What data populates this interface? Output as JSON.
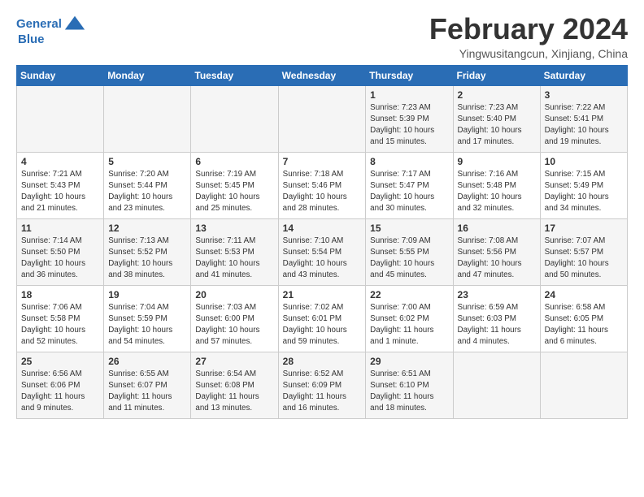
{
  "header": {
    "logo_line1": "General",
    "logo_line2": "Blue",
    "title": "February 2024",
    "location": "Yingwusitangcun, Xinjiang, China"
  },
  "days_of_week": [
    "Sunday",
    "Monday",
    "Tuesday",
    "Wednesday",
    "Thursday",
    "Friday",
    "Saturday"
  ],
  "weeks": [
    [
      {
        "day": "",
        "info": ""
      },
      {
        "day": "",
        "info": ""
      },
      {
        "day": "",
        "info": ""
      },
      {
        "day": "",
        "info": ""
      },
      {
        "day": "1",
        "info": "Sunrise: 7:23 AM\nSunset: 5:39 PM\nDaylight: 10 hours\nand 15 minutes."
      },
      {
        "day": "2",
        "info": "Sunrise: 7:23 AM\nSunset: 5:40 PM\nDaylight: 10 hours\nand 17 minutes."
      },
      {
        "day": "3",
        "info": "Sunrise: 7:22 AM\nSunset: 5:41 PM\nDaylight: 10 hours\nand 19 minutes."
      }
    ],
    [
      {
        "day": "4",
        "info": "Sunrise: 7:21 AM\nSunset: 5:43 PM\nDaylight: 10 hours\nand 21 minutes."
      },
      {
        "day": "5",
        "info": "Sunrise: 7:20 AM\nSunset: 5:44 PM\nDaylight: 10 hours\nand 23 minutes."
      },
      {
        "day": "6",
        "info": "Sunrise: 7:19 AM\nSunset: 5:45 PM\nDaylight: 10 hours\nand 25 minutes."
      },
      {
        "day": "7",
        "info": "Sunrise: 7:18 AM\nSunset: 5:46 PM\nDaylight: 10 hours\nand 28 minutes."
      },
      {
        "day": "8",
        "info": "Sunrise: 7:17 AM\nSunset: 5:47 PM\nDaylight: 10 hours\nand 30 minutes."
      },
      {
        "day": "9",
        "info": "Sunrise: 7:16 AM\nSunset: 5:48 PM\nDaylight: 10 hours\nand 32 minutes."
      },
      {
        "day": "10",
        "info": "Sunrise: 7:15 AM\nSunset: 5:49 PM\nDaylight: 10 hours\nand 34 minutes."
      }
    ],
    [
      {
        "day": "11",
        "info": "Sunrise: 7:14 AM\nSunset: 5:50 PM\nDaylight: 10 hours\nand 36 minutes."
      },
      {
        "day": "12",
        "info": "Sunrise: 7:13 AM\nSunset: 5:52 PM\nDaylight: 10 hours\nand 38 minutes."
      },
      {
        "day": "13",
        "info": "Sunrise: 7:11 AM\nSunset: 5:53 PM\nDaylight: 10 hours\nand 41 minutes."
      },
      {
        "day": "14",
        "info": "Sunrise: 7:10 AM\nSunset: 5:54 PM\nDaylight: 10 hours\nand 43 minutes."
      },
      {
        "day": "15",
        "info": "Sunrise: 7:09 AM\nSunset: 5:55 PM\nDaylight: 10 hours\nand 45 minutes."
      },
      {
        "day": "16",
        "info": "Sunrise: 7:08 AM\nSunset: 5:56 PM\nDaylight: 10 hours\nand 47 minutes."
      },
      {
        "day": "17",
        "info": "Sunrise: 7:07 AM\nSunset: 5:57 PM\nDaylight: 10 hours\nand 50 minutes."
      }
    ],
    [
      {
        "day": "18",
        "info": "Sunrise: 7:06 AM\nSunset: 5:58 PM\nDaylight: 10 hours\nand 52 minutes."
      },
      {
        "day": "19",
        "info": "Sunrise: 7:04 AM\nSunset: 5:59 PM\nDaylight: 10 hours\nand 54 minutes."
      },
      {
        "day": "20",
        "info": "Sunrise: 7:03 AM\nSunset: 6:00 PM\nDaylight: 10 hours\nand 57 minutes."
      },
      {
        "day": "21",
        "info": "Sunrise: 7:02 AM\nSunset: 6:01 PM\nDaylight: 10 hours\nand 59 minutes."
      },
      {
        "day": "22",
        "info": "Sunrise: 7:00 AM\nSunset: 6:02 PM\nDaylight: 11 hours\nand 1 minute."
      },
      {
        "day": "23",
        "info": "Sunrise: 6:59 AM\nSunset: 6:03 PM\nDaylight: 11 hours\nand 4 minutes."
      },
      {
        "day": "24",
        "info": "Sunrise: 6:58 AM\nSunset: 6:05 PM\nDaylight: 11 hours\nand 6 minutes."
      }
    ],
    [
      {
        "day": "25",
        "info": "Sunrise: 6:56 AM\nSunset: 6:06 PM\nDaylight: 11 hours\nand 9 minutes."
      },
      {
        "day": "26",
        "info": "Sunrise: 6:55 AM\nSunset: 6:07 PM\nDaylight: 11 hours\nand 11 minutes."
      },
      {
        "day": "27",
        "info": "Sunrise: 6:54 AM\nSunset: 6:08 PM\nDaylight: 11 hours\nand 13 minutes."
      },
      {
        "day": "28",
        "info": "Sunrise: 6:52 AM\nSunset: 6:09 PM\nDaylight: 11 hours\nand 16 minutes."
      },
      {
        "day": "29",
        "info": "Sunrise: 6:51 AM\nSunset: 6:10 PM\nDaylight: 11 hours\nand 18 minutes."
      },
      {
        "day": "",
        "info": ""
      },
      {
        "day": "",
        "info": ""
      }
    ]
  ]
}
